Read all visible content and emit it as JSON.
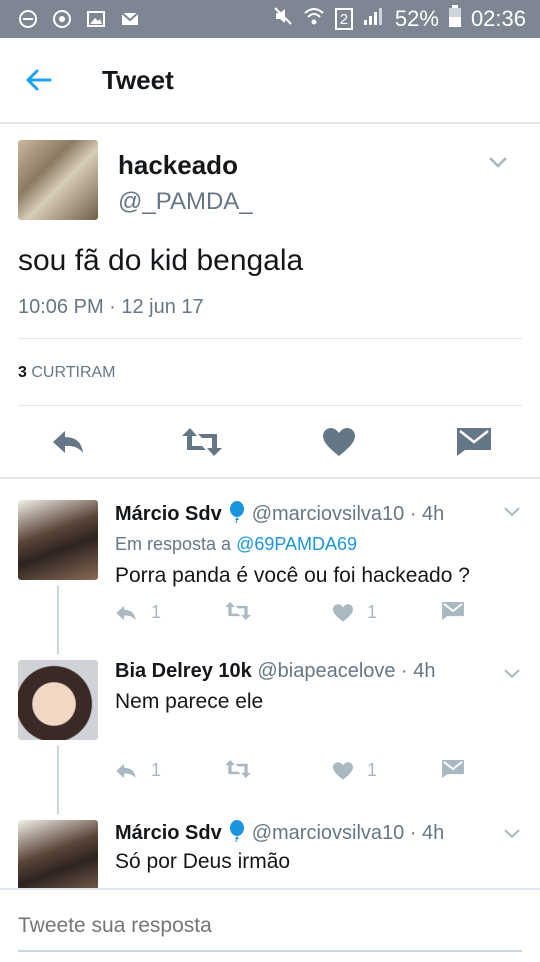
{
  "status_bar": {
    "battery": "52%",
    "time": "02:36",
    "sim": "2"
  },
  "header": {
    "title": "Tweet"
  },
  "tweet": {
    "name": "hackeado",
    "handle": "@_PAMDA_",
    "text": "sou fã do kid bengala",
    "timestamp": "10:06 PM · 12 jun 17",
    "likes_count": "3",
    "likes_label": "CURTIRAM"
  },
  "replies": [
    {
      "name": "Márcio Sdv",
      "handle": "@marciovsilva10 · 4h",
      "in_reply_prefix": "Em resposta a",
      "in_reply_handle": "@69PAMDA69",
      "text": "Porra panda é você ou foi hackeado ?",
      "reply_count": "1",
      "like_count": "1"
    },
    {
      "name": "Bia Delrey 10k",
      "handle": "@biapeacelove · 4h",
      "text": "Nem parece ele",
      "reply_count": "1",
      "like_count": "1"
    },
    {
      "name": "Márcio Sdv",
      "handle": "@marciovsilva10 · 4h",
      "text": "Só por Deus irmão"
    }
  ],
  "composer": {
    "placeholder": "Tweete sua resposta"
  },
  "colors": {
    "accent": "#1da1f2",
    "status_bar": "#7d8692",
    "muted": "#657786",
    "icon": "#657786"
  }
}
